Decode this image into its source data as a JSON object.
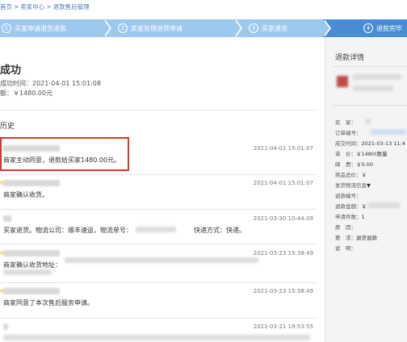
{
  "breadcrumb": [
    "首页",
    ">",
    "卖家中心",
    ">",
    "退款售后管理"
  ],
  "steps": [
    {
      "num": "1",
      "label": "买家申请退货退款"
    },
    {
      "num": "2",
      "label": "卖家处理退货申请"
    },
    {
      "num": "3",
      "label": "买家退货"
    },
    {
      "num": "4",
      "label": "退款完毕"
    }
  ],
  "status": {
    "title": "成功",
    "time_label": "成功时间：2021-04-01 15:01:08",
    "amount_label": "额：￥1480.00元"
  },
  "history_title": "历史",
  "history": [
    {
      "date": "2021-04-01 15:01:07",
      "message": "商家主动同意，退款给买家1480.00元。"
    },
    {
      "date": "2021-04-01 15:01:07",
      "message": "商家确认收货。"
    },
    {
      "date": "2021-03-30 10:44:09",
      "message": "买家退货。物流公司：顺丰速运，物流单号：",
      "suffix": "快递方式：快递。"
    },
    {
      "date": "2021-03-23 15:38:49",
      "message": "商家确认收货地址："
    },
    {
      "date": "2021-03-23 15:38:49",
      "message": "商家同意了本次售后服务申请。"
    },
    {
      "date": "2021-03-21 19:53:55",
      "message": ""
    }
  ],
  "detail": {
    "title": "退款详情",
    "rows": [
      {
        "label": "买　家：",
        "value": ""
      },
      {
        "label": "订单编号：",
        "value": ""
      },
      {
        "label": "成交时间：",
        "value": "2021-03-13 11:4"
      },
      {
        "label": "单　价：",
        "value": "￥1480(数量"
      },
      {
        "label": "邮　费：",
        "value": "￥0.00"
      },
      {
        "label": "商品总价：",
        "value": "￥"
      },
      {
        "label": "发货物流信息",
        "value": "▼"
      },
      {
        "label": "退款编号：",
        "value": ""
      },
      {
        "label": "退款金额：",
        "value": "￥"
      },
      {
        "label": "申请件数：",
        "value": "1"
      },
      {
        "label": "原　因：",
        "value": ""
      },
      {
        "label": "要　求：",
        "value": "退货退款"
      },
      {
        "label": "说　明：",
        "value": ""
      }
    ]
  },
  "colors": {
    "step_light": "#9ec9ee",
    "step_dark": "#4a8cd4",
    "highlight": "#d9362b"
  }
}
